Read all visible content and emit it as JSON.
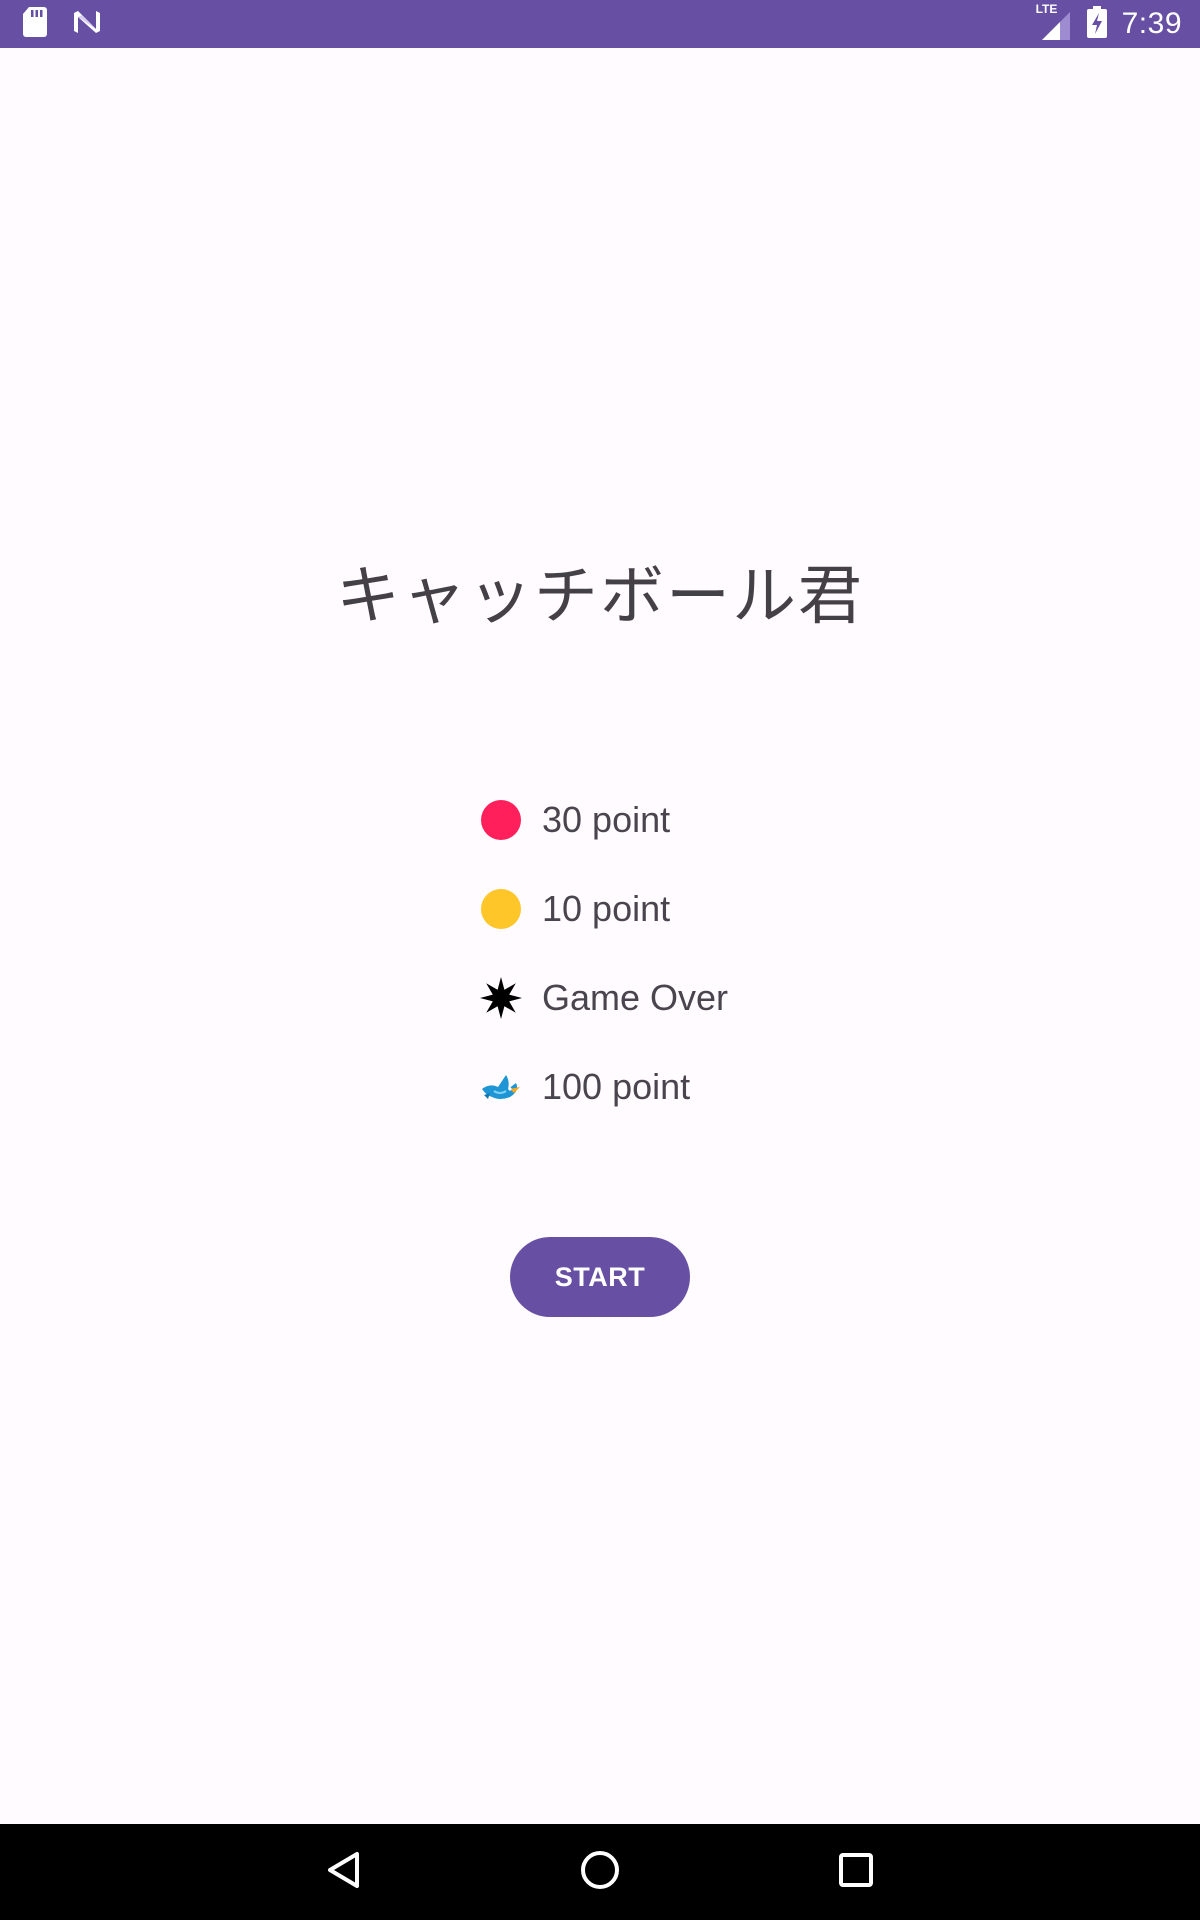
{
  "status_bar": {
    "time": "7:39",
    "network_label": "LTE",
    "left_icons": [
      "sd-card-icon",
      "n-notification-icon"
    ],
    "right_icons": [
      "lte-signal-icon",
      "battery-charging-icon"
    ],
    "color": "#6750a4"
  },
  "main": {
    "title": "キャッチボール君",
    "legend": [
      {
        "icon": "red-ball-icon",
        "color": "#ff1f5a",
        "label": "30 point"
      },
      {
        "icon": "yellow-ball-icon",
        "color": "#ffc629",
        "label": "10 point"
      },
      {
        "icon": "black-star-icon",
        "color": "#000000",
        "label": "Game Over"
      },
      {
        "icon": "blue-bird-icon",
        "color": "#1e96d6",
        "label": "100 point"
      }
    ],
    "start_label": "START",
    "accent_color": "#6750a4"
  },
  "nav_bar": {
    "icons": [
      "back-triangle-icon",
      "home-circle-icon",
      "recents-square-icon"
    ]
  }
}
